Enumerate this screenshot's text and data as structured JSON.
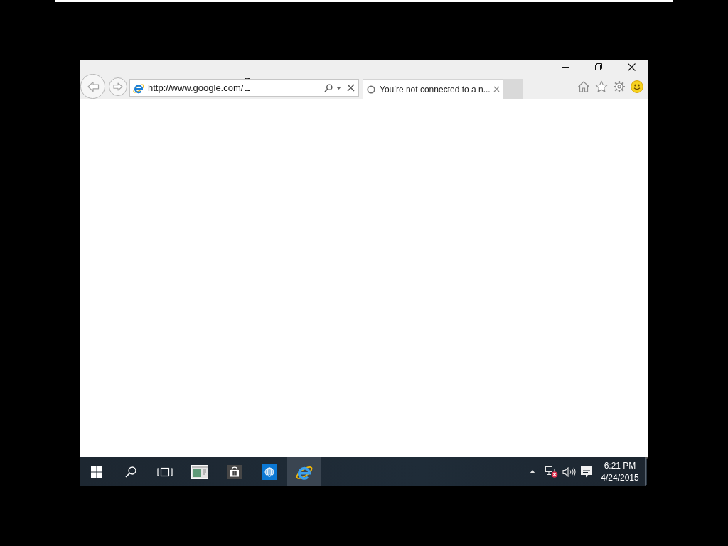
{
  "browser": {
    "address_bar": {
      "value": "http://www.google.com/"
    },
    "tabs": [
      {
        "title": "You’re not connected to a n...",
        "selected": true,
        "loading": true
      }
    ]
  },
  "taskbar": {
    "pinned": [
      {
        "kind": "server-manager",
        "active": false
      },
      {
        "kind": "store",
        "active": false
      },
      {
        "kind": "globe",
        "active": false
      },
      {
        "kind": "ie",
        "active": true
      }
    ],
    "tray": {
      "network_connected": false
    },
    "clock": {
      "time": "6:21 PM",
      "date": "4/24/2015"
    }
  }
}
